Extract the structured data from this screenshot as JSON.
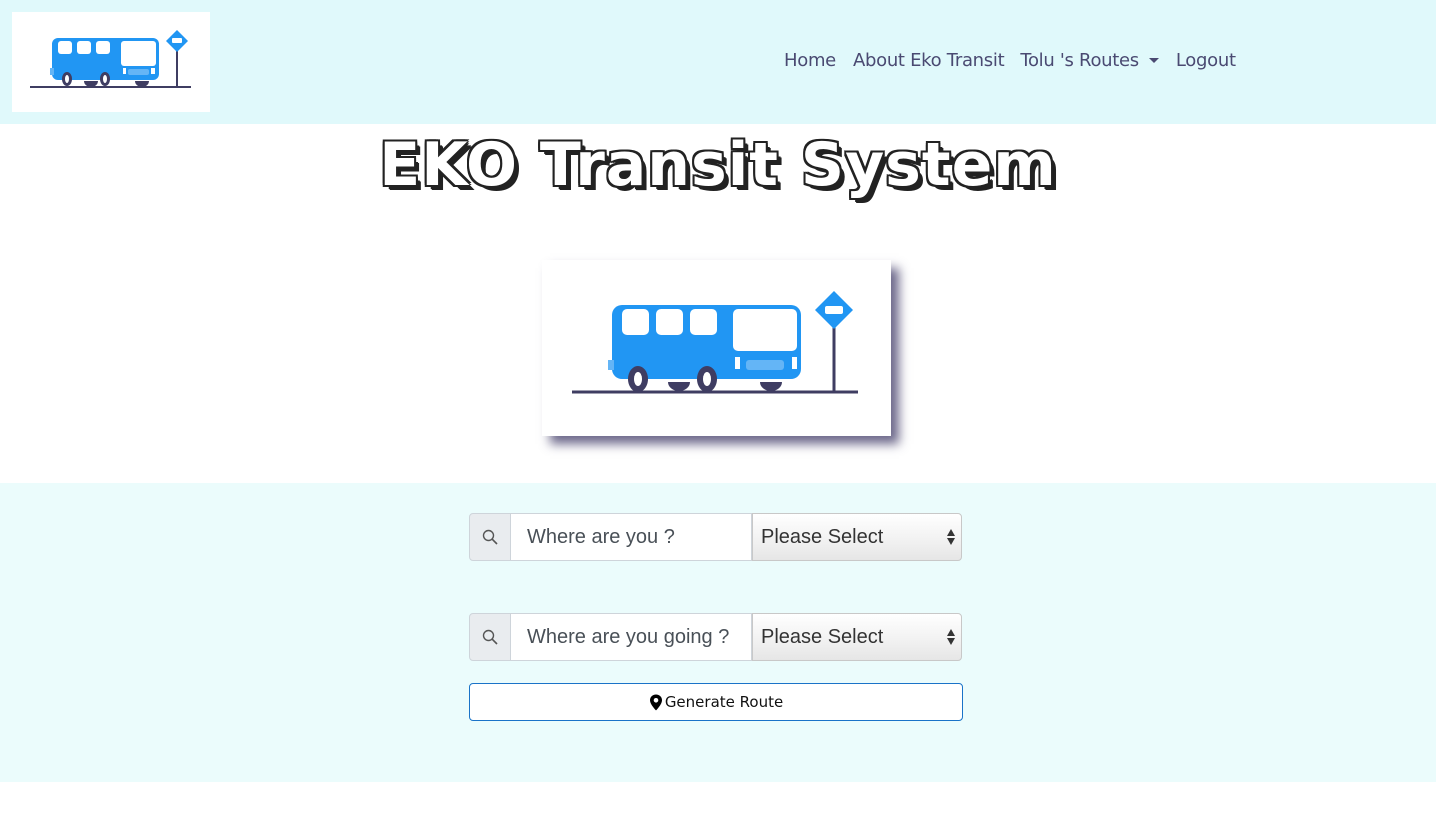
{
  "nav": {
    "logo_icon": "bus-stop-logo",
    "links": [
      {
        "label": "Home"
      },
      {
        "label": "About Eko Transit"
      },
      {
        "label": "Tolu 's Routes"
      },
      {
        "label": "Logout"
      }
    ]
  },
  "hero": {
    "title": "EKO Transit System",
    "image_icon": "bus-at-stop-illustration"
  },
  "form": {
    "origin": {
      "placeholder": "Where are you ?",
      "select_value": "Please Select"
    },
    "destination": {
      "placeholder": "Where are you going ?",
      "select_value": "Please Select"
    },
    "generate_label": "Generate Route",
    "generate_icon": "map-pin-icon"
  },
  "colors": {
    "nav_bg": "#e0f9fb",
    "form_bg": "#ebfcfc",
    "bus_blue": "#2196f3",
    "nav_text": "#4a4a72",
    "button_border": "#1a73c8"
  }
}
